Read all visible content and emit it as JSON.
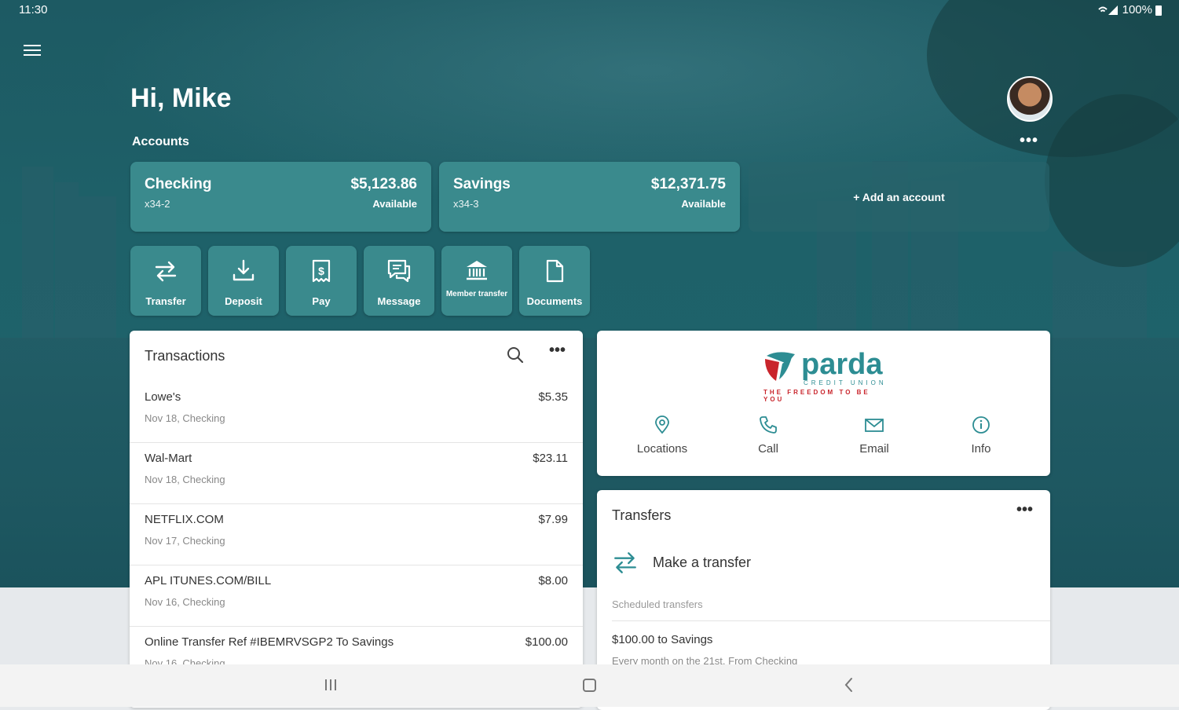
{
  "status_bar": {
    "time": "11:30",
    "battery": "100%"
  },
  "greeting": "Hi, Mike",
  "accounts_label": "Accounts",
  "accounts": [
    {
      "name": "Checking",
      "number": "x34-2",
      "balance": "$5,123.86",
      "balance_label": "Available"
    },
    {
      "name": "Savings",
      "number": "x34-3",
      "balance": "$12,371.75",
      "balance_label": "Available"
    }
  ],
  "add_account_label": "+ Add an account",
  "more_label": "•••",
  "quick_actions": [
    {
      "label": "Transfer",
      "icon": "transfer-icon"
    },
    {
      "label": "Deposit",
      "icon": "deposit-icon"
    },
    {
      "label": "Pay",
      "icon": "pay-icon"
    },
    {
      "label": "Message",
      "icon": "message-icon"
    },
    {
      "label": "Member transfer",
      "icon": "bank-icon"
    },
    {
      "label": "Documents",
      "icon": "document-icon"
    }
  ],
  "transactions": {
    "title": "Transactions",
    "items": [
      {
        "merchant": "Lowe's",
        "detail": "Nov 18, Checking",
        "amount": "$5.35"
      },
      {
        "merchant": "Wal-Mart",
        "detail": "Nov 18, Checking",
        "amount": "$23.11"
      },
      {
        "merchant": "NETFLIX.COM",
        "detail": "Nov 17, Checking",
        "amount": "$7.99"
      },
      {
        "merchant": "APL ITUNES.COM/BILL",
        "detail": "Nov 16, Checking",
        "amount": "$8.00"
      },
      {
        "merchant": "Online Transfer Ref #IBEMRVSGP2 To Savings",
        "detail": "Nov 16, Checking",
        "amount": "$100.00"
      }
    ]
  },
  "credit_union": {
    "logo_word": "parda",
    "logo_sub": "CREDIT UNION",
    "tagline": "THE FREEDOM TO BE YOU",
    "links": [
      {
        "label": "Locations",
        "icon": "location-pin-icon"
      },
      {
        "label": "Call",
        "icon": "phone-icon"
      },
      {
        "label": "Email",
        "icon": "email-icon"
      },
      {
        "label": "Info",
        "icon": "info-icon"
      }
    ]
  },
  "transfers": {
    "title": "Transfers",
    "make_label": "Make a transfer",
    "scheduled_label": "Scheduled transfers",
    "scheduled": [
      {
        "title": "$100.00 to Savings",
        "detail": "Every month on the 21st. From Checking"
      }
    ]
  },
  "colors": {
    "primary": "#1f626a",
    "tile": "#3a8a8d",
    "accent": "#2d8d93",
    "brand_red": "#c9252c"
  }
}
